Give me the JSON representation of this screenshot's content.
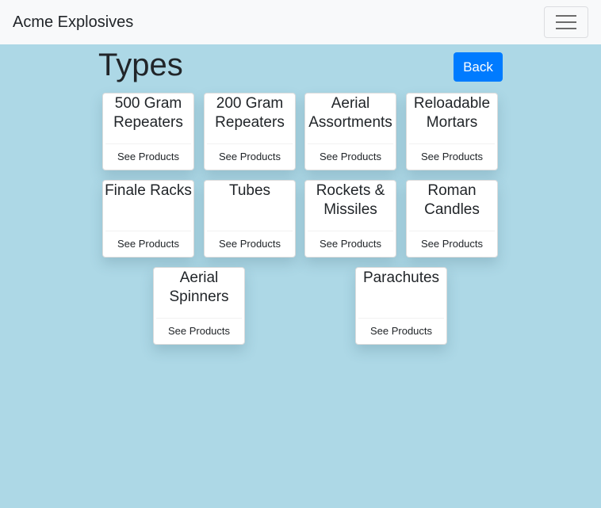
{
  "navbar": {
    "brand": "Acme Explosives",
    "toggler_icon": "hamburger-menu-icon"
  },
  "page": {
    "title": "Types",
    "back_label": "Back"
  },
  "colors": {
    "background": "#add8e6",
    "navbar": "#f8f9fa",
    "primary": "#007bff"
  },
  "types": [
    {
      "name": "500 Gram Repeaters",
      "action": "See Products"
    },
    {
      "name": "200 Gram Repeaters",
      "action": "See Products"
    },
    {
      "name": "Aerial Assortments",
      "action": "See Products"
    },
    {
      "name": "Reloadable Mortars",
      "action": "See Products"
    },
    {
      "name": "Finale Racks",
      "action": "See Products"
    },
    {
      "name": "Tubes",
      "action": "See Products"
    },
    {
      "name": "Rockets & Missiles",
      "action": "See Products"
    },
    {
      "name": "Roman Candles",
      "action": "See Products"
    },
    {
      "name": "Aerial Spinners",
      "action": "See Products"
    },
    {
      "name": "Parachutes",
      "action": "See Products"
    }
  ]
}
